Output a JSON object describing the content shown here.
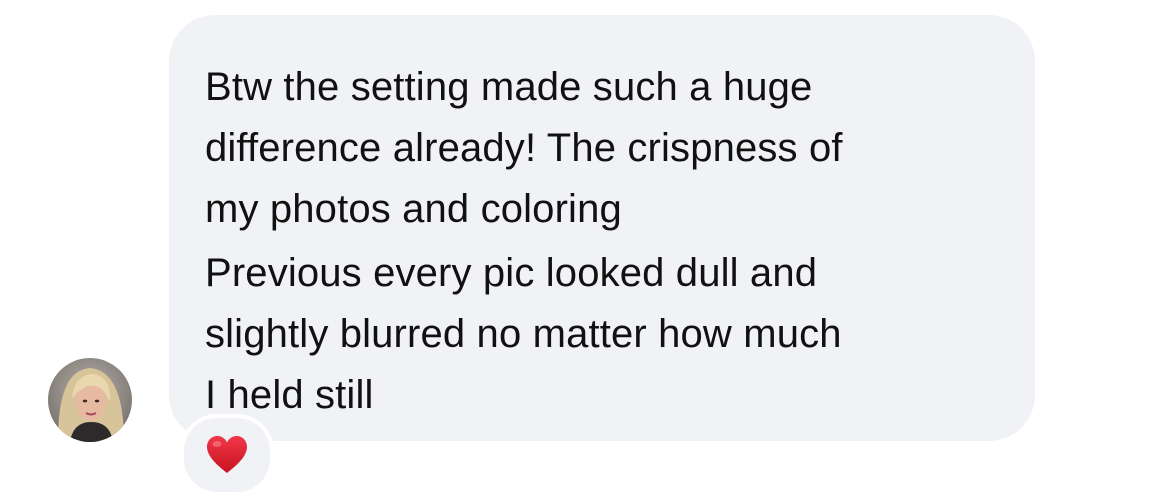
{
  "message": {
    "paragraphs": [
      {
        "lines": [
          "Btw the setting made such a huge",
          "difference already! The crispness of",
          "my photos and coloring"
        ]
      },
      {
        "lines": [
          "Previous every pic looked dull and",
          "slightly blurred no matter how much",
          "I held still"
        ]
      }
    ],
    "bubble_color": "#f1f2f5",
    "text_color": "#111111"
  },
  "sender": {
    "avatar_icon": "avatar-photo"
  },
  "reaction": {
    "icon": "red-heart-icon",
    "color": "#e0212b"
  }
}
